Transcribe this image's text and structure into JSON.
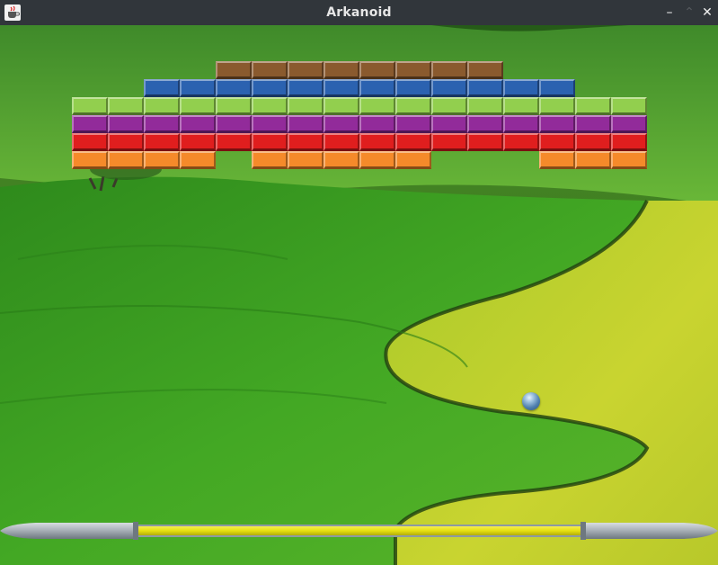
{
  "window": {
    "title": "Arkanoid",
    "buttons": {
      "minimize": "–",
      "maximize": "⌃",
      "close": "✕"
    }
  },
  "icons": {
    "app": "java-cup-icon",
    "minimize": "minimize-icon",
    "maximize": "maximize-icon",
    "close": "close-icon"
  },
  "colors": {
    "titlebar": "#31363b",
    "brown": "#8a5a2e",
    "blue": "#2b62b0",
    "lightgreen": "#92cf4e",
    "purple": "#922b9a",
    "red": "#e01e1e",
    "orange": "#f58a2a",
    "paddle_bar": "#e9e312",
    "paddle_cap": "#a9b1b8"
  },
  "game": {
    "brick_rows": [
      {
        "color": "brown",
        "cols": [
          6,
          7,
          8,
          9,
          10,
          11,
          12,
          13
        ]
      },
      {
        "color": "blue",
        "cols": [
          4,
          5,
          6,
          7,
          8,
          9,
          10,
          11,
          12,
          13,
          14,
          15
        ]
      },
      {
        "color": "lightgreen",
        "cols": [
          2,
          3,
          4,
          5,
          6,
          7,
          8,
          9,
          10,
          11,
          12,
          13,
          14,
          15,
          16,
          17
        ]
      },
      {
        "color": "purple",
        "cols": [
          2,
          3,
          4,
          5,
          6,
          7,
          8,
          9,
          10,
          11,
          12,
          13,
          14,
          15,
          16,
          17
        ]
      },
      {
        "color": "red",
        "cols": [
          2,
          3,
          4,
          5,
          6,
          7,
          8,
          9,
          10,
          11,
          12,
          13,
          14,
          15,
          16,
          17
        ]
      },
      {
        "color": "orange",
        "cols": [
          2,
          3,
          4,
          5,
          7,
          8,
          9,
          10,
          11,
          15,
          16,
          17
        ]
      }
    ]
  }
}
